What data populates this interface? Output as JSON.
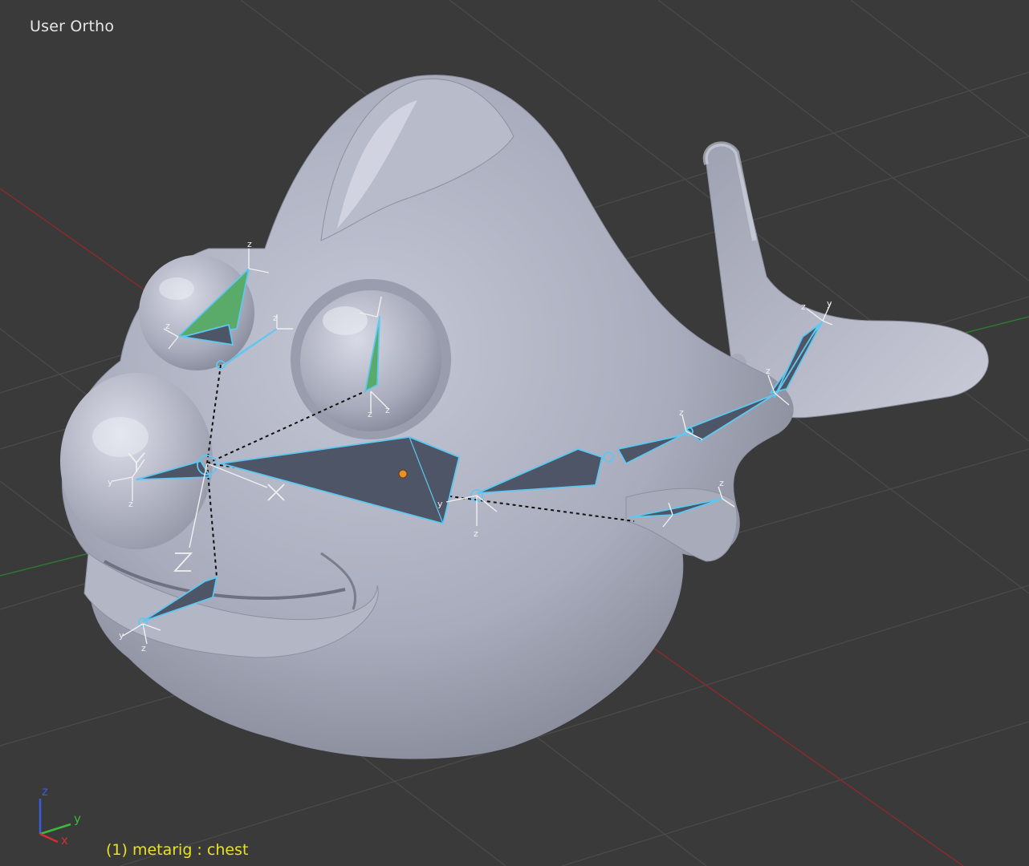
{
  "viewport": {
    "view_label": "User Ortho",
    "status_text": "(1) metarig : chest",
    "object": "fish-mesh",
    "armature": "metarig",
    "active_bone": "chest"
  },
  "axis_gizmo": {
    "labels": {
      "z": "z",
      "y": "y",
      "x": "x"
    },
    "colors": {
      "z": "#3b5bdc",
      "y": "#3cb83c",
      "x": "#d03030"
    }
  },
  "colors": {
    "background": "#3a3a3a",
    "grid": "#4a4a4a",
    "x_axis": "#8a2a2a",
    "y_axis": "#2e7a2e",
    "bone_outline": "#5ec8f0",
    "bone_fill": "#4d5566",
    "bone_green": "#5aaa6a",
    "mesh": "#b9bccb",
    "origin_dot": "#e8902a",
    "status_text": "#e8e02a",
    "view_label": "#e6e6e6"
  }
}
